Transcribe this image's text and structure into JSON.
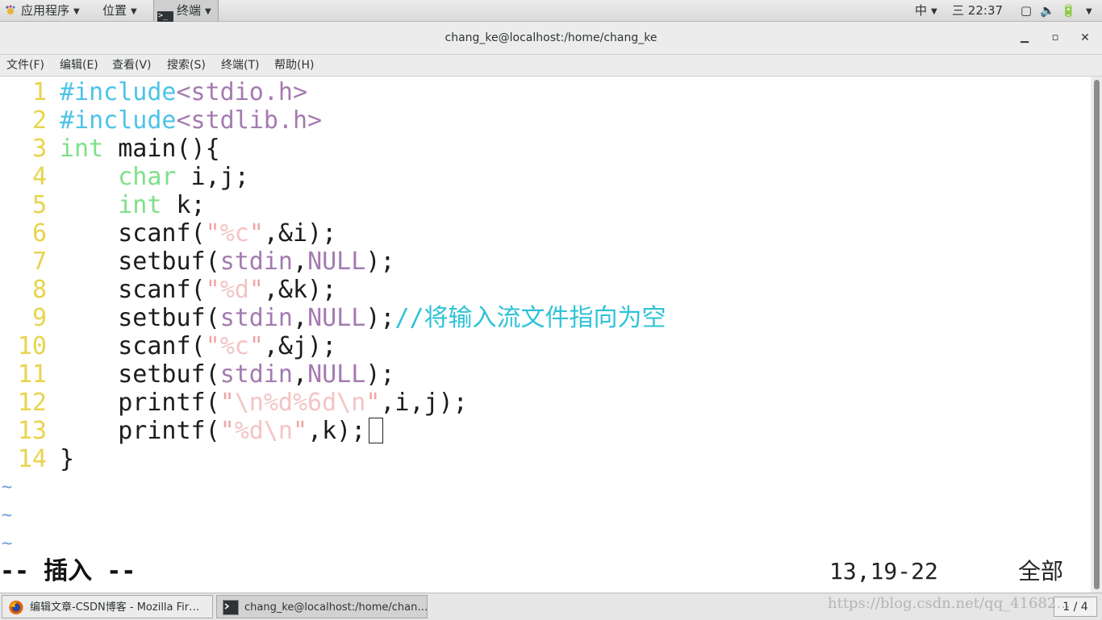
{
  "top_panel": {
    "apps_label": "应用程序",
    "places_label": "位置",
    "terminal_label": "终端",
    "ime_label": "中",
    "clock": "22:37",
    "clock_prefix": "三"
  },
  "window": {
    "title": "chang_ke@localhost:/home/chang_ke"
  },
  "menubar": {
    "items": [
      "文件(F)",
      "编辑(E)",
      "查看(V)",
      "搜索(S)",
      "终端(T)",
      "帮助(H)"
    ]
  },
  "editor": {
    "line_numbers": [
      "1",
      "2",
      "3",
      "4",
      "5",
      "6",
      "7",
      "8",
      "9",
      "10",
      "11",
      "12",
      "13",
      "14"
    ],
    "lines": [
      [
        {
          "t": "#include",
          "c": "pre"
        },
        {
          "t": "<stdio.h>",
          "c": "inc"
        }
      ],
      [
        {
          "t": "#include",
          "c": "pre"
        },
        {
          "t": "<stdlib.h>",
          "c": "inc"
        }
      ],
      [
        {
          "t": "int",
          "c": "type"
        },
        {
          "t": " main(){",
          "c": "plain"
        }
      ],
      [
        {
          "t": "    ",
          "c": "plain"
        },
        {
          "t": "char",
          "c": "type"
        },
        {
          "t": " i,j;",
          "c": "plain"
        }
      ],
      [
        {
          "t": "    ",
          "c": "plain"
        },
        {
          "t": "int",
          "c": "type"
        },
        {
          "t": " k;",
          "c": "plain"
        }
      ],
      [
        {
          "t": "    scanf(",
          "c": "plain"
        },
        {
          "t": "\"",
          "c": "quote"
        },
        {
          "t": "%c",
          "c": "str"
        },
        {
          "t": "\"",
          "c": "quote"
        },
        {
          "t": ",&i);",
          "c": "plain"
        }
      ],
      [
        {
          "t": "    setbuf(",
          "c": "plain"
        },
        {
          "t": "stdin",
          "c": "const"
        },
        {
          "t": ",",
          "c": "plain"
        },
        {
          "t": "NULL",
          "c": "const"
        },
        {
          "t": ");",
          "c": "plain"
        }
      ],
      [
        {
          "t": "    scanf(",
          "c": "plain"
        },
        {
          "t": "\"",
          "c": "quote"
        },
        {
          "t": "%d",
          "c": "str"
        },
        {
          "t": "\"",
          "c": "quote"
        },
        {
          "t": ",&k);",
          "c": "plain"
        }
      ],
      [
        {
          "t": "    setbuf(",
          "c": "plain"
        },
        {
          "t": "stdin",
          "c": "const"
        },
        {
          "t": ",",
          "c": "plain"
        },
        {
          "t": "NULL",
          "c": "const"
        },
        {
          "t": ");",
          "c": "plain"
        },
        {
          "t": "//将输入流文件指向为空",
          "c": "comment"
        }
      ],
      [
        {
          "t": "    scanf(",
          "c": "plain"
        },
        {
          "t": "\"",
          "c": "quote"
        },
        {
          "t": "%c",
          "c": "str"
        },
        {
          "t": "\"",
          "c": "quote"
        },
        {
          "t": ",&j);",
          "c": "plain"
        }
      ],
      [
        {
          "t": "    setbuf(",
          "c": "plain"
        },
        {
          "t": "stdin",
          "c": "const"
        },
        {
          "t": ",",
          "c": "plain"
        },
        {
          "t": "NULL",
          "c": "const"
        },
        {
          "t": ");",
          "c": "plain"
        }
      ],
      [
        {
          "t": "    printf(",
          "c": "plain"
        },
        {
          "t": "\"",
          "c": "quote"
        },
        {
          "t": "\\n%d%6d\\n",
          "c": "str"
        },
        {
          "t": "\"",
          "c": "quote"
        },
        {
          "t": ",i,j);",
          "c": "plain"
        }
      ],
      [
        {
          "t": "    printf(",
          "c": "plain"
        },
        {
          "t": "\"",
          "c": "quote"
        },
        {
          "t": "%d\\n",
          "c": "str"
        },
        {
          "t": "\"",
          "c": "quote"
        },
        {
          "t": ",k);",
          "c": "plain"
        }
      ],
      [
        {
          "t": "}",
          "c": "plain"
        }
      ]
    ],
    "cursor_line": 13,
    "tildes": [
      "~",
      "~",
      "~"
    ],
    "status_mode": "-- 插入 --",
    "status_position": "13,19-22",
    "status_scroll": "全部"
  },
  "taskbar": {
    "firefox_label": "编辑文章-CSDN博客 - Mozilla Fir…",
    "terminal_label": "chang_ke@localhost:/home/chan…",
    "workspace": "1 / 4"
  },
  "watermark": "https://blog.csdn.net/qq_41682...",
  "colors": {
    "preprocessor": "#4dc3e8",
    "include_path": "#a47bb0",
    "type_keyword": "#7fe08a",
    "string": "#f3c4c4",
    "comment": "#2fc2d8",
    "line_number": "#e8d44d",
    "tilde": "#6a9fd8"
  }
}
